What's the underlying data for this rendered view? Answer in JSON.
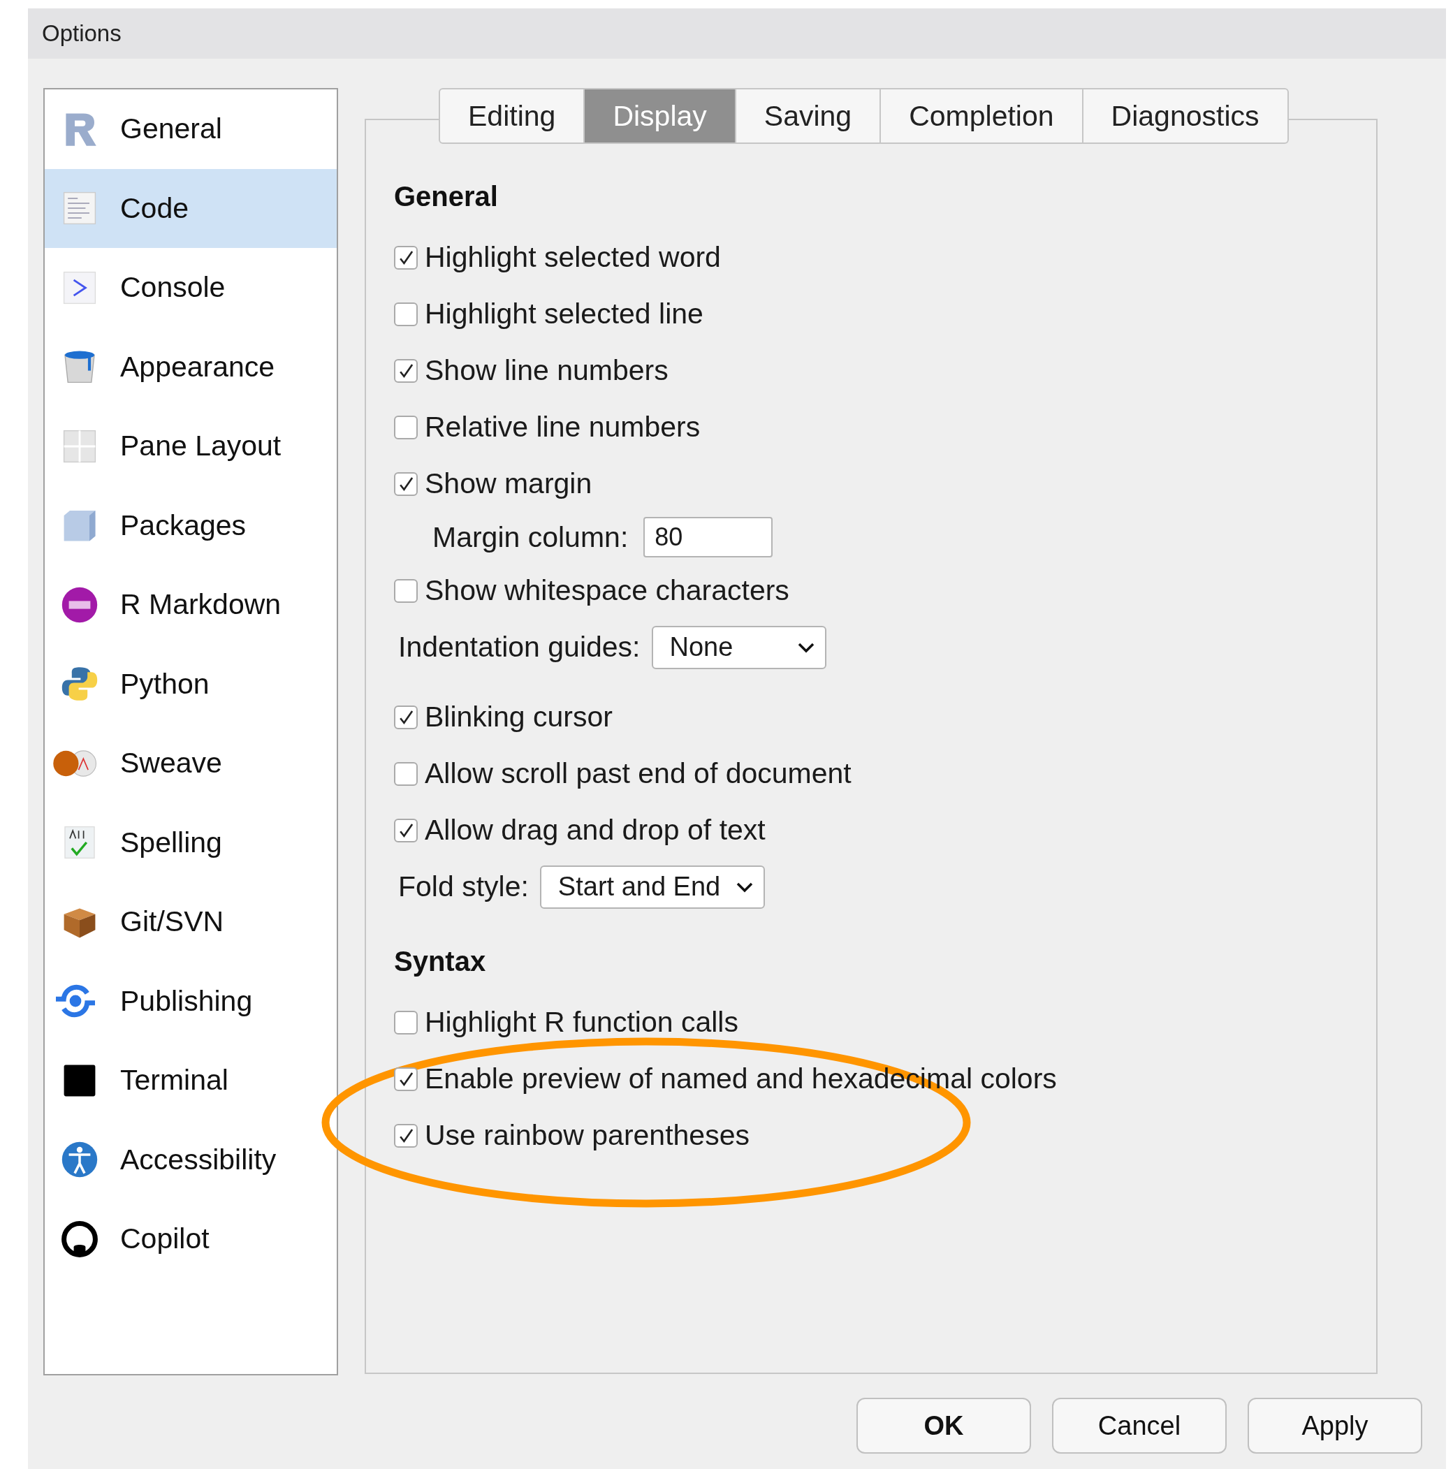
{
  "window": {
    "title": "Options"
  },
  "sidebar": {
    "items": [
      {
        "label": "General",
        "selected": false
      },
      {
        "label": "Code",
        "selected": true
      },
      {
        "label": "Console",
        "selected": false
      },
      {
        "label": "Appearance",
        "selected": false
      },
      {
        "label": "Pane Layout",
        "selected": false
      },
      {
        "label": "Packages",
        "selected": false
      },
      {
        "label": "R Markdown",
        "selected": false
      },
      {
        "label": "Python",
        "selected": false
      },
      {
        "label": "Sweave",
        "selected": false
      },
      {
        "label": "Spelling",
        "selected": false
      },
      {
        "label": "Git/SVN",
        "selected": false
      },
      {
        "label": "Publishing",
        "selected": false
      },
      {
        "label": "Terminal",
        "selected": false
      },
      {
        "label": "Accessibility",
        "selected": false
      },
      {
        "label": "Copilot",
        "selected": false
      }
    ]
  },
  "tabs": [
    {
      "label": "Editing",
      "selected": false
    },
    {
      "label": "Display",
      "selected": true
    },
    {
      "label": "Saving",
      "selected": false
    },
    {
      "label": "Completion",
      "selected": false
    },
    {
      "label": "Diagnostics",
      "selected": false
    }
  ],
  "sections": [
    {
      "heading": "General",
      "items": [
        {
          "kind": "checkbox",
          "label": "Highlight selected word",
          "checked": true
        },
        {
          "kind": "checkbox",
          "label": "Highlight selected line",
          "checked": false
        },
        {
          "kind": "checkbox",
          "label": "Show line numbers",
          "checked": true
        },
        {
          "kind": "checkbox",
          "label": "Relative line numbers",
          "checked": false
        },
        {
          "kind": "checkbox",
          "label": "Show margin",
          "checked": true
        },
        {
          "kind": "textfield",
          "label": "Margin column:",
          "value": "80"
        },
        {
          "kind": "checkbox",
          "label": "Show whitespace characters",
          "checked": false
        },
        {
          "kind": "dropdown",
          "label": "Indentation guides:",
          "value": "None"
        },
        {
          "kind": "checkbox",
          "label": "Blinking cursor",
          "checked": true
        },
        {
          "kind": "checkbox",
          "label": "Allow scroll past end of document",
          "checked": false
        },
        {
          "kind": "checkbox",
          "label": "Allow drag and drop of text",
          "checked": true
        },
        {
          "kind": "dropdown",
          "label": "Fold style:",
          "value": "Start and End"
        }
      ]
    },
    {
      "heading": "Syntax",
      "items": [
        {
          "kind": "checkbox",
          "label": "Highlight R function calls",
          "checked": false
        },
        {
          "kind": "checkbox",
          "label": "Enable preview of named and hexadecimal colors",
          "checked": true
        },
        {
          "kind": "checkbox",
          "label": "Use rainbow parentheses",
          "checked": true
        }
      ]
    }
  ],
  "buttons": [
    "OK",
    "Cancel",
    "Apply"
  ]
}
